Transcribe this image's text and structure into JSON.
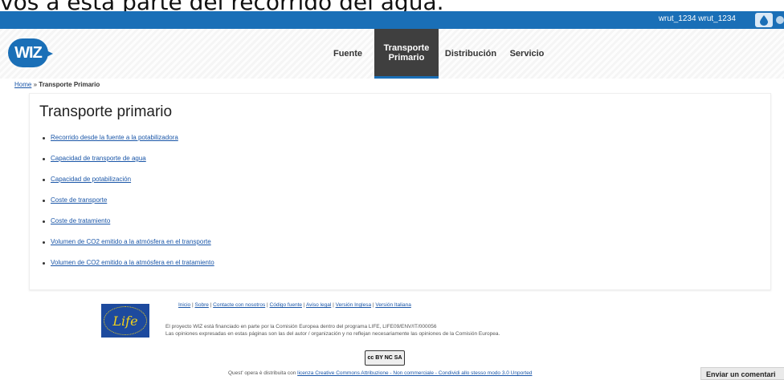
{
  "caption": "vos a esta parte del recorrido del agua.",
  "topbar": {
    "user": "wrut_1234 wrut_1234"
  },
  "logo": "WIZ",
  "nav": [
    {
      "label": "Fuente"
    },
    {
      "label": "Transporte Primario",
      "active": true
    },
    {
      "label": "Distribución"
    },
    {
      "label": "Servicio"
    }
  ],
  "breadcrumb": {
    "home": "Home",
    "sep": " » ",
    "current": "Transporte Primario"
  },
  "main": {
    "title": "Transporte primario",
    "links": [
      "Recorrido desde la fuente a la potabilizadora",
      "Capacidad de transporte de agua",
      "Capacidad de potabilización",
      "Coste de transporte",
      "Coste de tratamiento",
      "Volumen de CO2 emitido a la atmósfera en el transporte",
      "Volumen de CO2 emitido a la atmósfera en el tratamiento"
    ]
  },
  "footer": {
    "links": [
      "Inicio",
      "Sobre",
      "Contacte con nosotros",
      "Código fuente",
      "Aviso legal",
      "Versión Inglesa",
      "Versión Italiana"
    ],
    "life_logo": "Life",
    "line1": "El proyecto WIZ está financiado en parte por la Comisión Europea dentro del programa LIFE, LIFE09/ENV/IT/000056",
    "line2": "Las opiniones expresadas en estas páginas son las del autor / organización y no reflejan necesariamente las opiniones de la Comisión Europea.",
    "cc_badge": "cc BY NC SA",
    "license_prefix": "Quest' opera è distribuita con ",
    "license_link": "licenza Creative Commons Attribuzione - Non commerciale - Condividi allo stesso modo 3.0 Unported"
  },
  "feedback_button": "Enviar un comentari",
  "colors": {
    "brand_blue": "#1a6fb7",
    "active_tab": "#3f3f3f",
    "link": "#1a56a8"
  }
}
